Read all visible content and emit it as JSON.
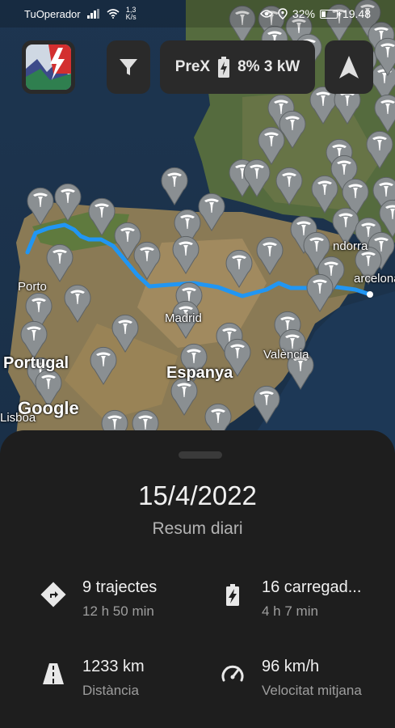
{
  "status_bar": {
    "carrier": "TuOperador",
    "net_speed_value": "1,3",
    "net_speed_unit": "K/s",
    "battery_percent": "32%",
    "battery_level": 0.32,
    "time": "19.48"
  },
  "top_bar": {
    "app_logo_icon": "abetterrouteplanner-logo",
    "filter_icon": "filter-icon",
    "car_name": "PreX",
    "car_battery_icon": "battery-charging-icon",
    "charge_status": "8% 3 kW",
    "navigation_icon": "navigation-arrow-icon"
  },
  "map": {
    "labels": {
      "porto": "Porto",
      "portugal": "Portugal",
      "madrid": "Madrid",
      "espanya": "Espanya",
      "valencia": "València",
      "lisboa": "Lisboa",
      "barcelona": "arcelona",
      "andorra": "ndorra"
    },
    "attribution": "Google",
    "route_color": "#2196f3",
    "marker_color": "#8a8f92",
    "marker_icon": "tesla-supercharger-icon"
  },
  "summary": {
    "date": "15/4/2022",
    "title": "Resum diari",
    "stats": [
      {
        "icon": "route-icon",
        "main": "9 trajectes",
        "sub": "12 h 50 min"
      },
      {
        "icon": "battery-charging-icon",
        "main": "16 carregad...",
        "sub": "4 h 7 min"
      },
      {
        "icon": "road-icon",
        "main": "1233 km",
        "sub": "Distància"
      },
      {
        "icon": "speedometer-icon",
        "main": "96 km/h",
        "sub": "Velocitat mitjana"
      }
    ]
  }
}
